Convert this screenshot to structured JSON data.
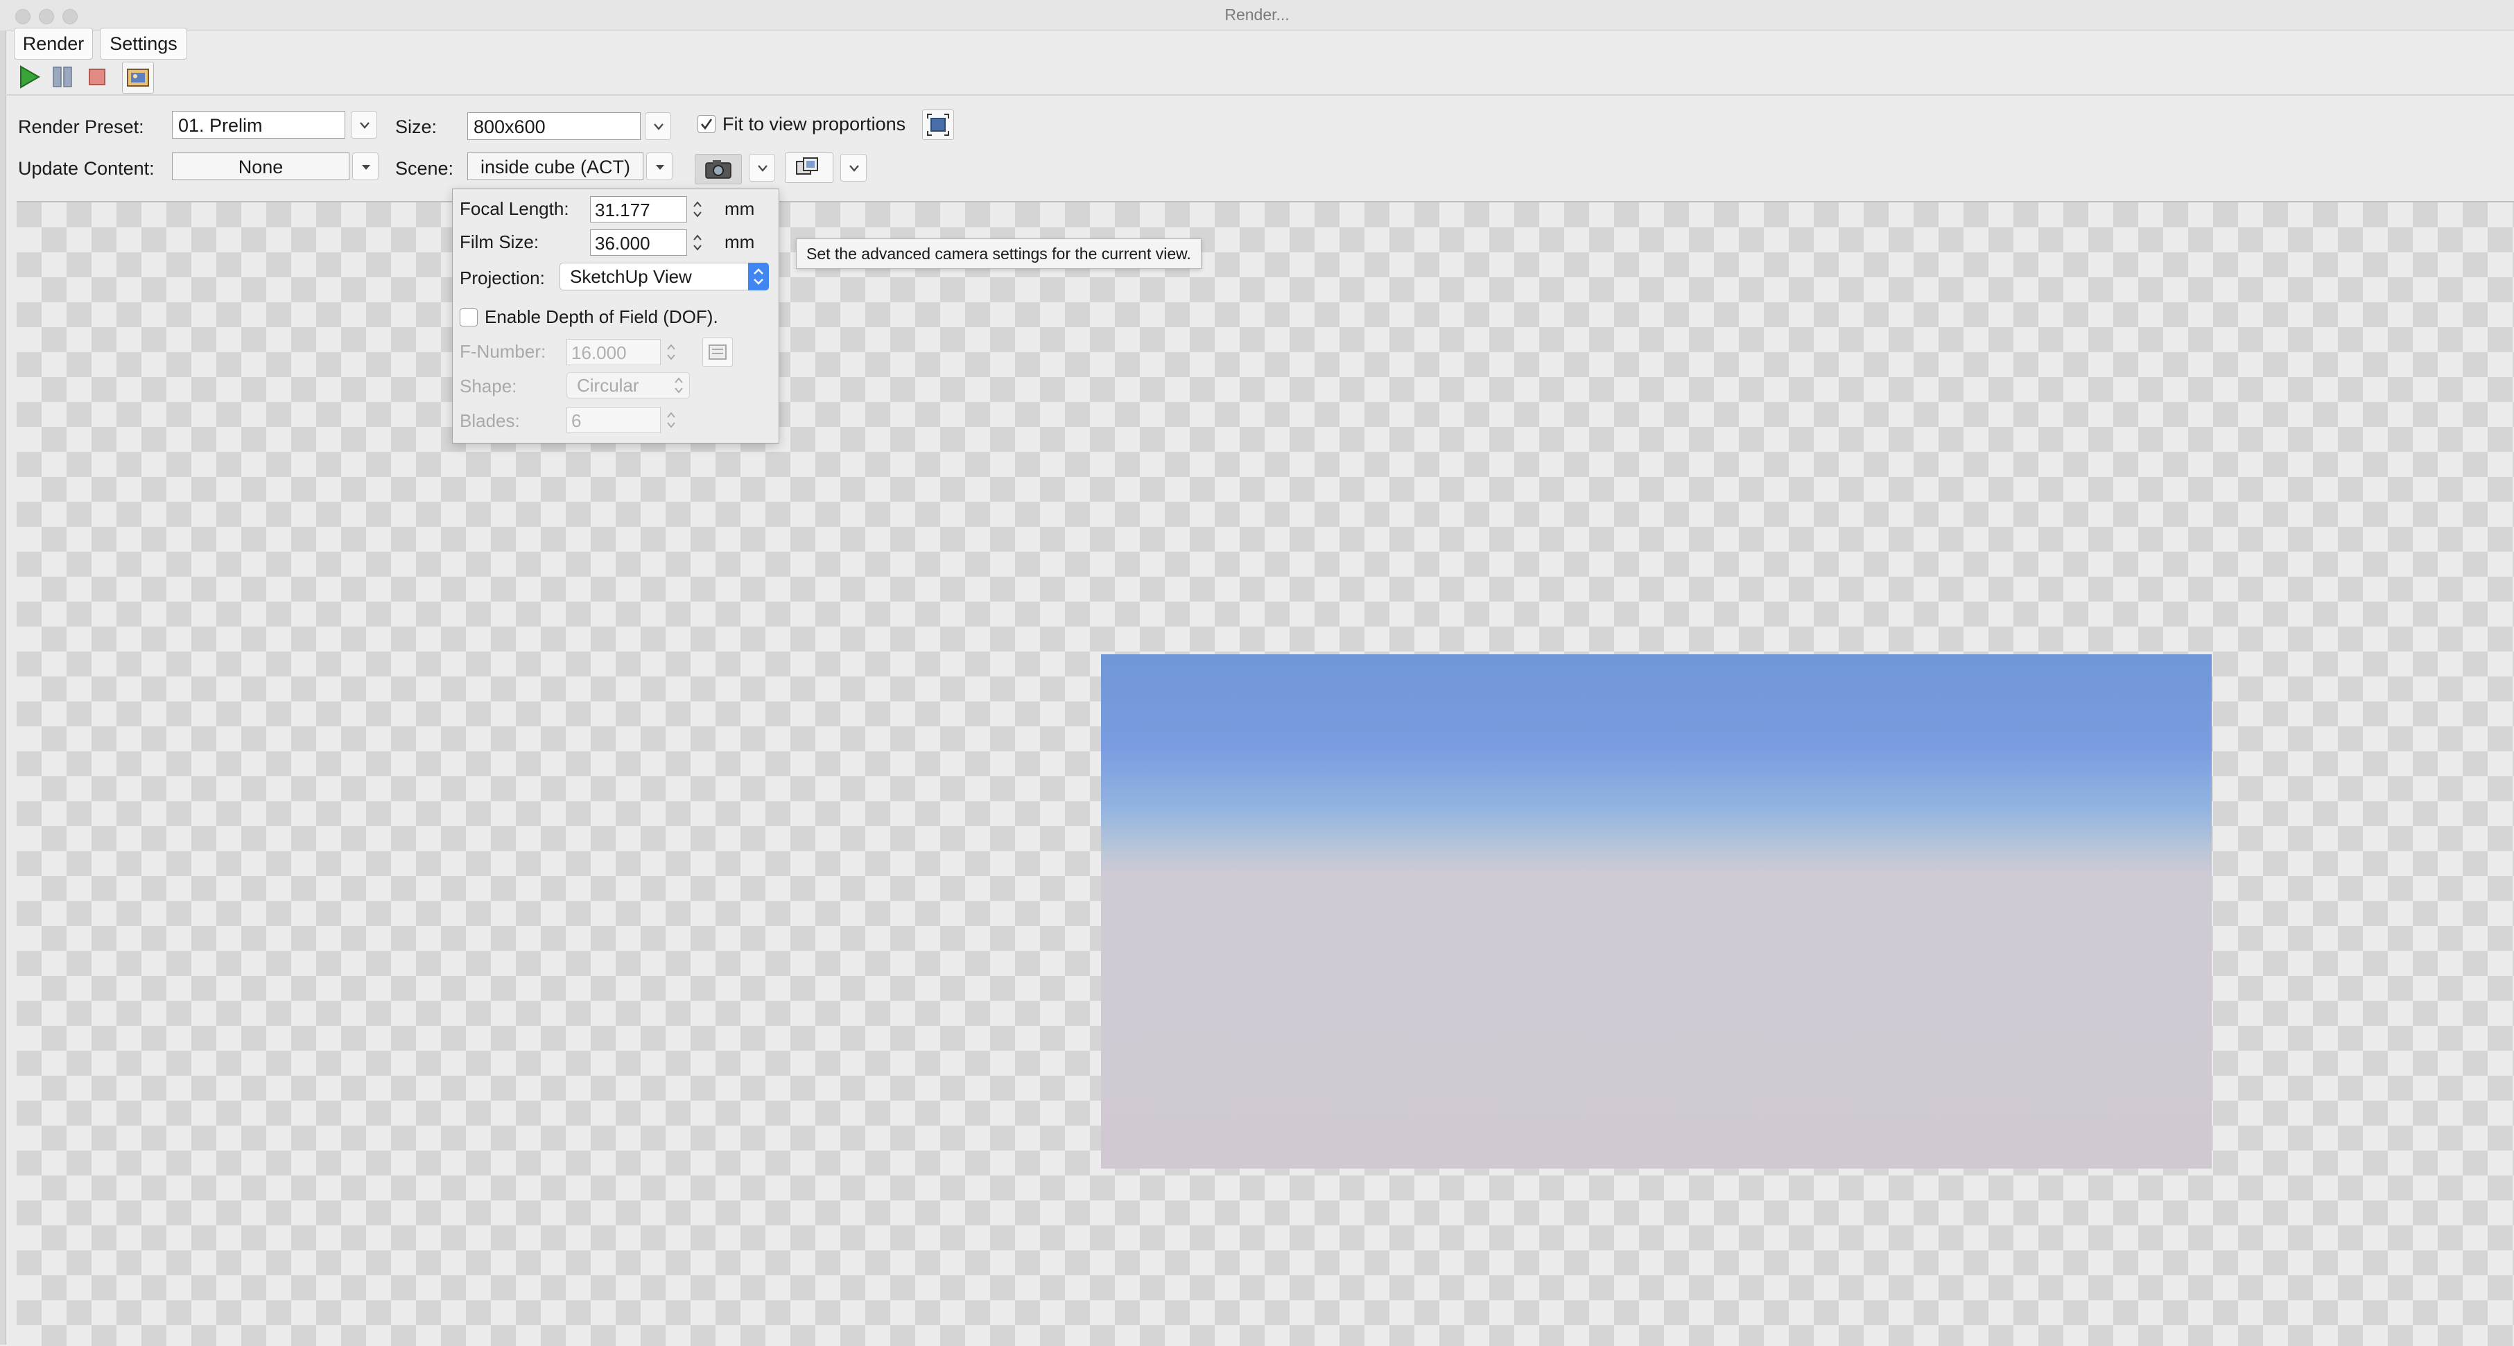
{
  "window": {
    "title": "Render..."
  },
  "menu": {
    "render_label": "Render",
    "settings_label": "Settings"
  },
  "toolbar": {
    "icons": [
      "play-icon",
      "pause-icon",
      "stop-icon",
      "render-frame-icon"
    ]
  },
  "settings": {
    "render_preset_label": "Render Preset:",
    "render_preset_value": "01. Prelim",
    "size_label": "Size:",
    "size_value": "800x600",
    "fit_checkbox_label": "Fit to view proportions",
    "fit_checked": true,
    "update_content_label": "Update Content:",
    "update_content_value": "None",
    "scene_label": "Scene:",
    "scene_value": "inside cube (ACT)"
  },
  "camera_popup": {
    "focal_length_label": "Focal Length:",
    "focal_length_value": "31.177",
    "focal_unit": "mm",
    "film_size_label": "Film Size:",
    "film_size_value": "36.000",
    "film_unit": "mm",
    "projection_label": "Projection:",
    "projection_value": "SketchUp View",
    "dof_label": "Enable Depth of Field (DOF).",
    "dof_checked": false,
    "fnumber_label": "F-Number:",
    "fnumber_value": "16.000",
    "shape_label": "Shape:",
    "shape_value": "Circular",
    "blades_label": "Blades:",
    "blades_value": "6"
  },
  "tooltip": {
    "text": "Set the advanced camera settings for the current view."
  },
  "colors": {
    "accent": "#3f86f0",
    "sky_top": "#7097d7",
    "ground": "#d0c9d2"
  }
}
